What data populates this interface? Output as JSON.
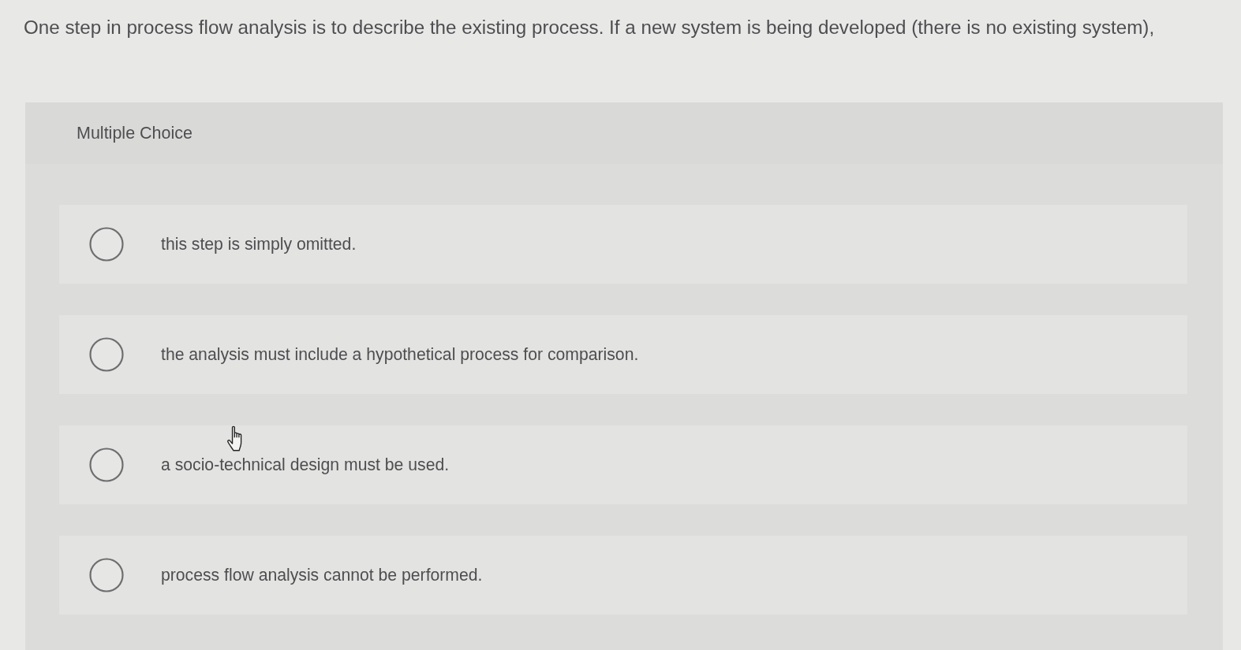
{
  "question": {
    "text": "One step in process flow analysis is to describe the existing process. If a new system is being developed (there is no existing system),"
  },
  "panel": {
    "title": "Multiple Choice"
  },
  "options": [
    {
      "label": "this step is simply omitted.",
      "selected": false
    },
    {
      "label": "the analysis must include a hypothetical process for comparison.",
      "selected": false
    },
    {
      "label": "a socio-technical design must be used.",
      "selected": false
    },
    {
      "label": "process flow analysis cannot be performed.",
      "selected": false
    }
  ]
}
